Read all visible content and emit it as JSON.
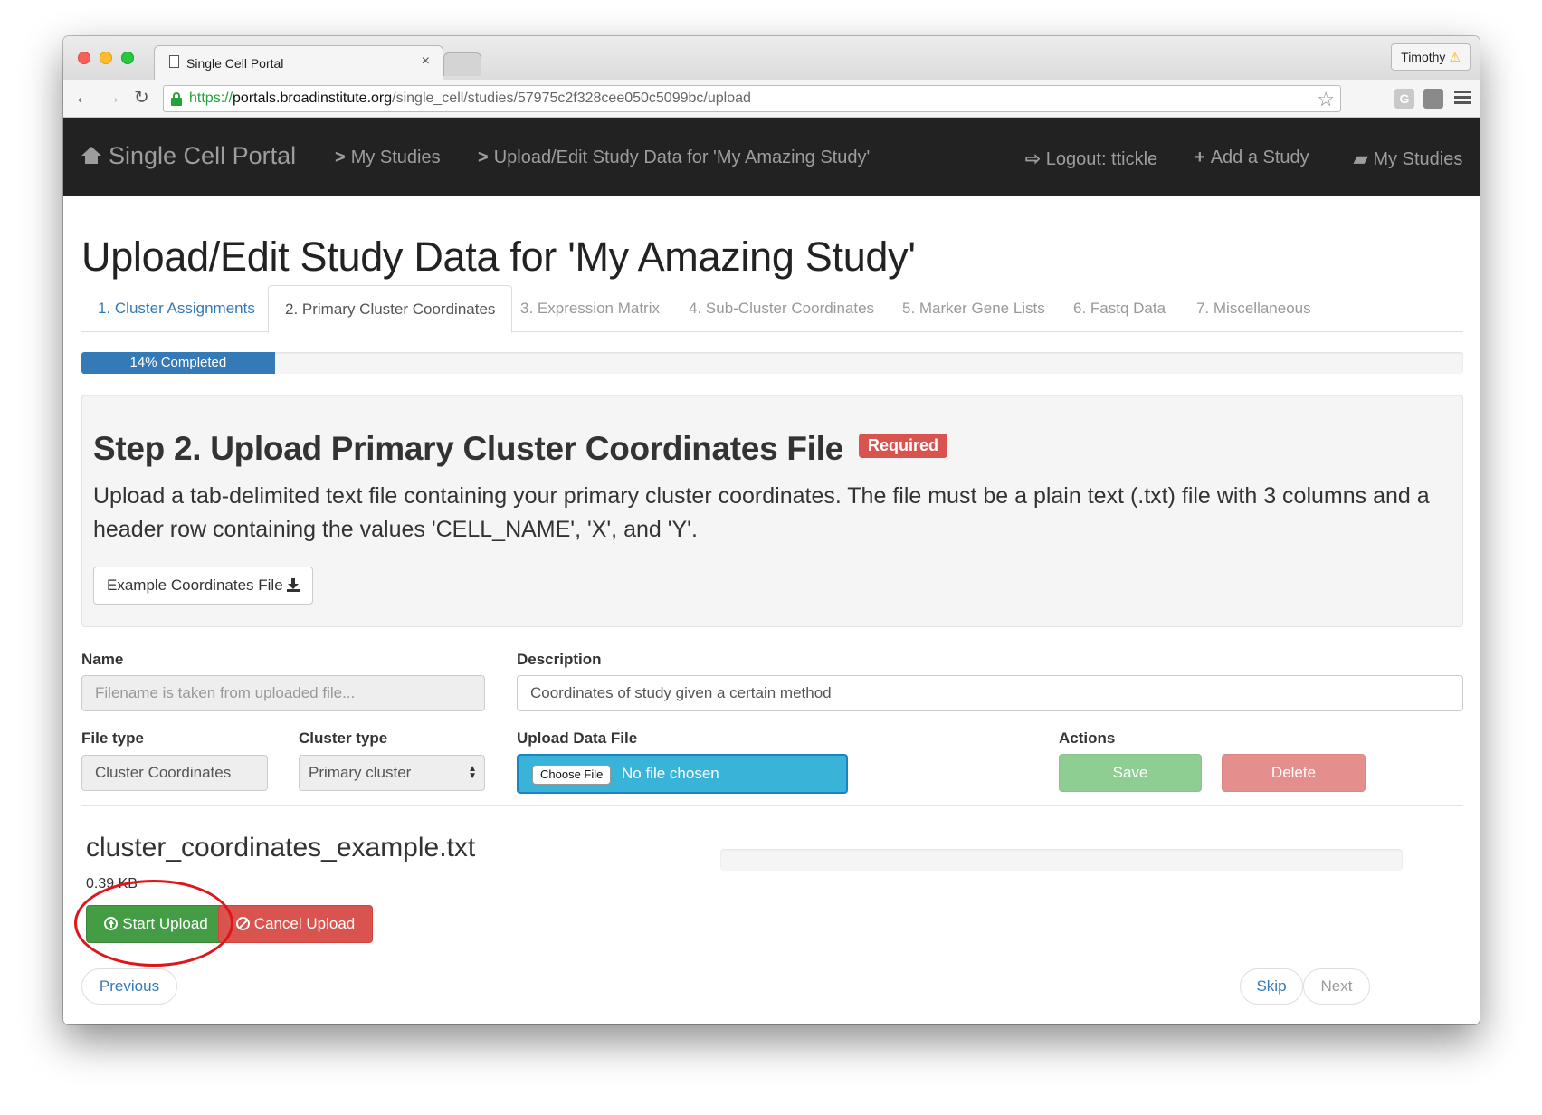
{
  "browser": {
    "tab_title": "Single Cell Portal",
    "tab_close": "×",
    "profile_name": "Timothy",
    "url_proto": "https://",
    "url_host": "portals.broadinstitute.org",
    "url_path": "/single_cell/studies/57975c2f328cee050c5099bc/upload",
    "ext_g_label": "G"
  },
  "navbar": {
    "brand": "Single Cell Portal",
    "chevron": ">",
    "my_studies": "My Studies",
    "upload_edit": "Upload/Edit Study Data for 'My Amazing Study'",
    "logout": "Logout: ttickle",
    "add_study": "Add a Study",
    "my_studies_right": "My Studies"
  },
  "page": {
    "title": "Upload/Edit Study Data for 'My Amazing Study'"
  },
  "tabs": [
    {
      "label": "1. Cluster Assignments",
      "state": "link"
    },
    {
      "label": "2. Primary Cluster Coordinates",
      "state": "active"
    },
    {
      "label": "3. Expression Matrix",
      "state": "disabled"
    },
    {
      "label": "4. Sub-Cluster Coordinates",
      "state": "disabled"
    },
    {
      "label": "5. Marker Gene Lists",
      "state": "disabled"
    },
    {
      "label": "6. Fastq Data",
      "state": "disabled"
    },
    {
      "label": "7. Miscellaneous",
      "state": "disabled"
    }
  ],
  "progress": {
    "label": "14% Completed",
    "percent": 14
  },
  "step": {
    "title": "Step 2. Upload Primary Cluster Coordinates File",
    "badge": "Required",
    "description": "Upload a tab-delimited text file containing your primary cluster coordinates. The file must be a plain text (.txt) file with 3 columns and a header row containing the values 'CELL_NAME', 'X', and 'Y'.",
    "example_button": "Example Coordinates File"
  },
  "form": {
    "name_label": "Name",
    "name_placeholder": "Filename is taken from uploaded file...",
    "description_label": "Description",
    "description_value": "Coordinates of study given a certain method",
    "file_type_label": "File type",
    "file_type_value": "Cluster Coordinates",
    "cluster_type_label": "Cluster type",
    "cluster_type_value": "Primary cluster",
    "upload_label": "Upload Data File",
    "choose_file": "Choose File",
    "no_file": "No file chosen",
    "actions_label": "Actions",
    "save": "Save",
    "delete": "Delete"
  },
  "pending_file": {
    "name": "cluster_coordinates_example.txt",
    "size": "0.39 KB",
    "start_upload": "Start Upload",
    "cancel_upload": "Cancel Upload"
  },
  "pager": {
    "previous": "Previous",
    "skip": "Skip",
    "next": "Next"
  },
  "colors": {
    "navbar_bg": "#222222",
    "primary": "#337ab7",
    "success": "#449d44",
    "danger": "#d9534f",
    "annotation": "#e0151b"
  }
}
